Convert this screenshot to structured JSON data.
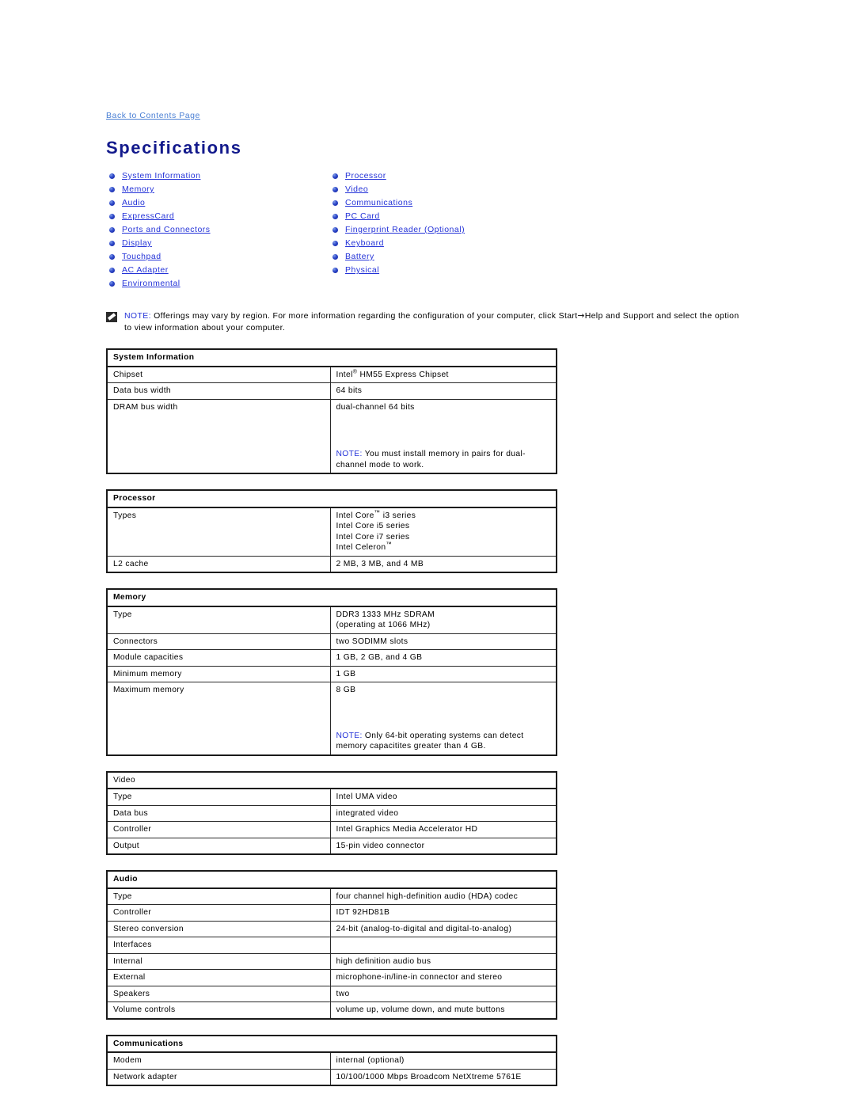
{
  "header": {
    "back_link": "Back to Contents Page",
    "page_title": "Specifications"
  },
  "toc": {
    "left_column": [
      "System Information",
      "Memory",
      "Audio",
      "ExpressCard",
      "Ports and Connectors",
      "Display",
      "Touchpad",
      "AC Adapter",
      "Environmental"
    ],
    "right_column": [
      "Processor",
      "Video",
      "Communications",
      "PC Card",
      "Fingerprint Reader (Optional)",
      "Keyboard",
      "Battery",
      "Physical"
    ]
  },
  "note": {
    "icon": "note-pencil-icon",
    "label": "NOTE:",
    "text_part1": " Offerings may vary by region. For more information regarding the configuration of your computer, click Start",
    "arrow": "→",
    "text_part2": "Help and Support and select the option to view information about your computer."
  },
  "tables": [
    {
      "id": "system-information",
      "heading": "System Information",
      "heading_bold": true,
      "rows": [
        {
          "label": "Chipset",
          "value_html": "Intel<sup>®</sup> HM55 Express Chipset",
          "value_text": "Intel® HM55 Express Chipset"
        },
        {
          "label": "Data bus width",
          "value_text": "64 bits"
        },
        {
          "label": "DRAM bus width",
          "value_text": "dual-channel 64 bits",
          "tall": "dram",
          "note_label": "NOTE:",
          "note_text": " You must install memory in pairs for dual-channel mode to work."
        }
      ]
    },
    {
      "id": "processor",
      "heading": "Processor",
      "heading_bold": true,
      "rows": [
        {
          "label": "Types",
          "tall": "types",
          "value_lines": [
            "Intel Core™ i3 series",
            "Intel Core i5 series",
            "Intel Core i7 series",
            "Intel Celeron™"
          ]
        },
        {
          "label": "L2 cache",
          "value_text": "2 MB, 3 MB, and 4 MB"
        }
      ]
    },
    {
      "id": "memory",
      "heading": "Memory",
      "heading_bold": true,
      "rows": [
        {
          "label": "Type",
          "value_lines": [
            "DDR3 1333 MHz SDRAM",
            "(operating at 1066 MHz)"
          ]
        },
        {
          "label": "Connectors",
          "value_text": "two SODIMM slots"
        },
        {
          "label": "Module capacities",
          "value_text": "1 GB, 2 GB, and 4 GB"
        },
        {
          "label": "Minimum memory",
          "value_text": "1 GB"
        },
        {
          "label": "Maximum memory",
          "value_text": "8 GB",
          "tall": "maxmem",
          "note_label": "NOTE:",
          "note_text": " Only 64-bit operating systems can detect memory capacitites greater than 4 GB."
        }
      ]
    },
    {
      "id": "video",
      "heading": "Video",
      "heading_bold": false,
      "rows": [
        {
          "label": "Type",
          "value_text": "Intel UMA video"
        },
        {
          "label": "Data bus",
          "value_text": "integrated video"
        },
        {
          "label": "Controller",
          "value_text": "Intel Graphics Media Accelerator HD"
        },
        {
          "label": "Output",
          "value_text": "15-pin video connector"
        }
      ]
    },
    {
      "id": "audio",
      "heading": "Audio",
      "heading_bold": true,
      "rows": [
        {
          "label": "Type",
          "value_text": "four channel high-definition audio (HDA) codec"
        },
        {
          "label": "Controller",
          "value_text": "IDT 92HD81B"
        },
        {
          "label": "Stereo conversion",
          "value_text": "24-bit (analog-to-digital and digital-to-analog)"
        },
        {
          "label": "Interfaces",
          "value_text": ""
        },
        {
          "label": "Internal",
          "indent": true,
          "value_text": "high definition audio bus"
        },
        {
          "label": "External",
          "indent": true,
          "value_text": "microphone-in/line-in connector and stereo"
        },
        {
          "label": "Speakers",
          "value_text": "two"
        },
        {
          "label": "Volume controls",
          "value_text": "volume up, volume down, and mute buttons"
        }
      ]
    },
    {
      "id": "communications",
      "heading": "Communications",
      "heading_bold": true,
      "clipped": true,
      "rows": [
        {
          "label": "Modem",
          "value_text": "internal (optional)"
        },
        {
          "label": "Network adapter",
          "value_text": "10/100/1000 Mbps Broadcom NetXtreme 5761E"
        }
      ]
    }
  ],
  "colors": {
    "title_blue": "#131a8c",
    "link_blue": "#2433d8",
    "back_link_blue": "#4a7fd4",
    "note_blue": "#2433d8",
    "border": "#1a1a1a",
    "background": "#ffffff"
  }
}
